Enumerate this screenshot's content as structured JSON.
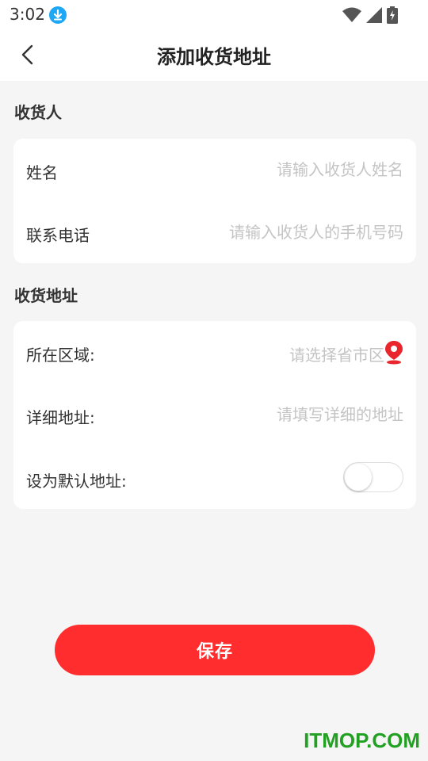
{
  "status_bar": {
    "time": "3:02",
    "icons": [
      "download-icon",
      "wifi-icon",
      "signal-icon",
      "battery-charging-icon"
    ]
  },
  "header": {
    "title": "添加收货地址",
    "back_icon": "chevron-left-icon"
  },
  "sections": {
    "recipient": {
      "title": "收货人",
      "name_label": "姓名",
      "name_placeholder": "请输入收货人姓名",
      "phone_label": "联系电话",
      "phone_placeholder": "请输入收货人的手机号码"
    },
    "address": {
      "title": "收货地址",
      "region_label": "所在区域:",
      "region_placeholder": "请选择省市区",
      "region_icon": "location-pin-icon",
      "detail_label": "详细地址:",
      "detail_placeholder": "请填写详细的地址",
      "default_label": "设为默认地址:",
      "default_enabled": false
    }
  },
  "save_button": {
    "label": "保存"
  },
  "watermark": "ITMOP.COM",
  "colors": {
    "accent": "#ff2d2d",
    "background": "#f5f5f5",
    "card": "#ffffff",
    "placeholder": "#c4c4c4",
    "pin": "#e8262b",
    "download_icon": "#1ea7f5",
    "watermark": "#22a022"
  }
}
